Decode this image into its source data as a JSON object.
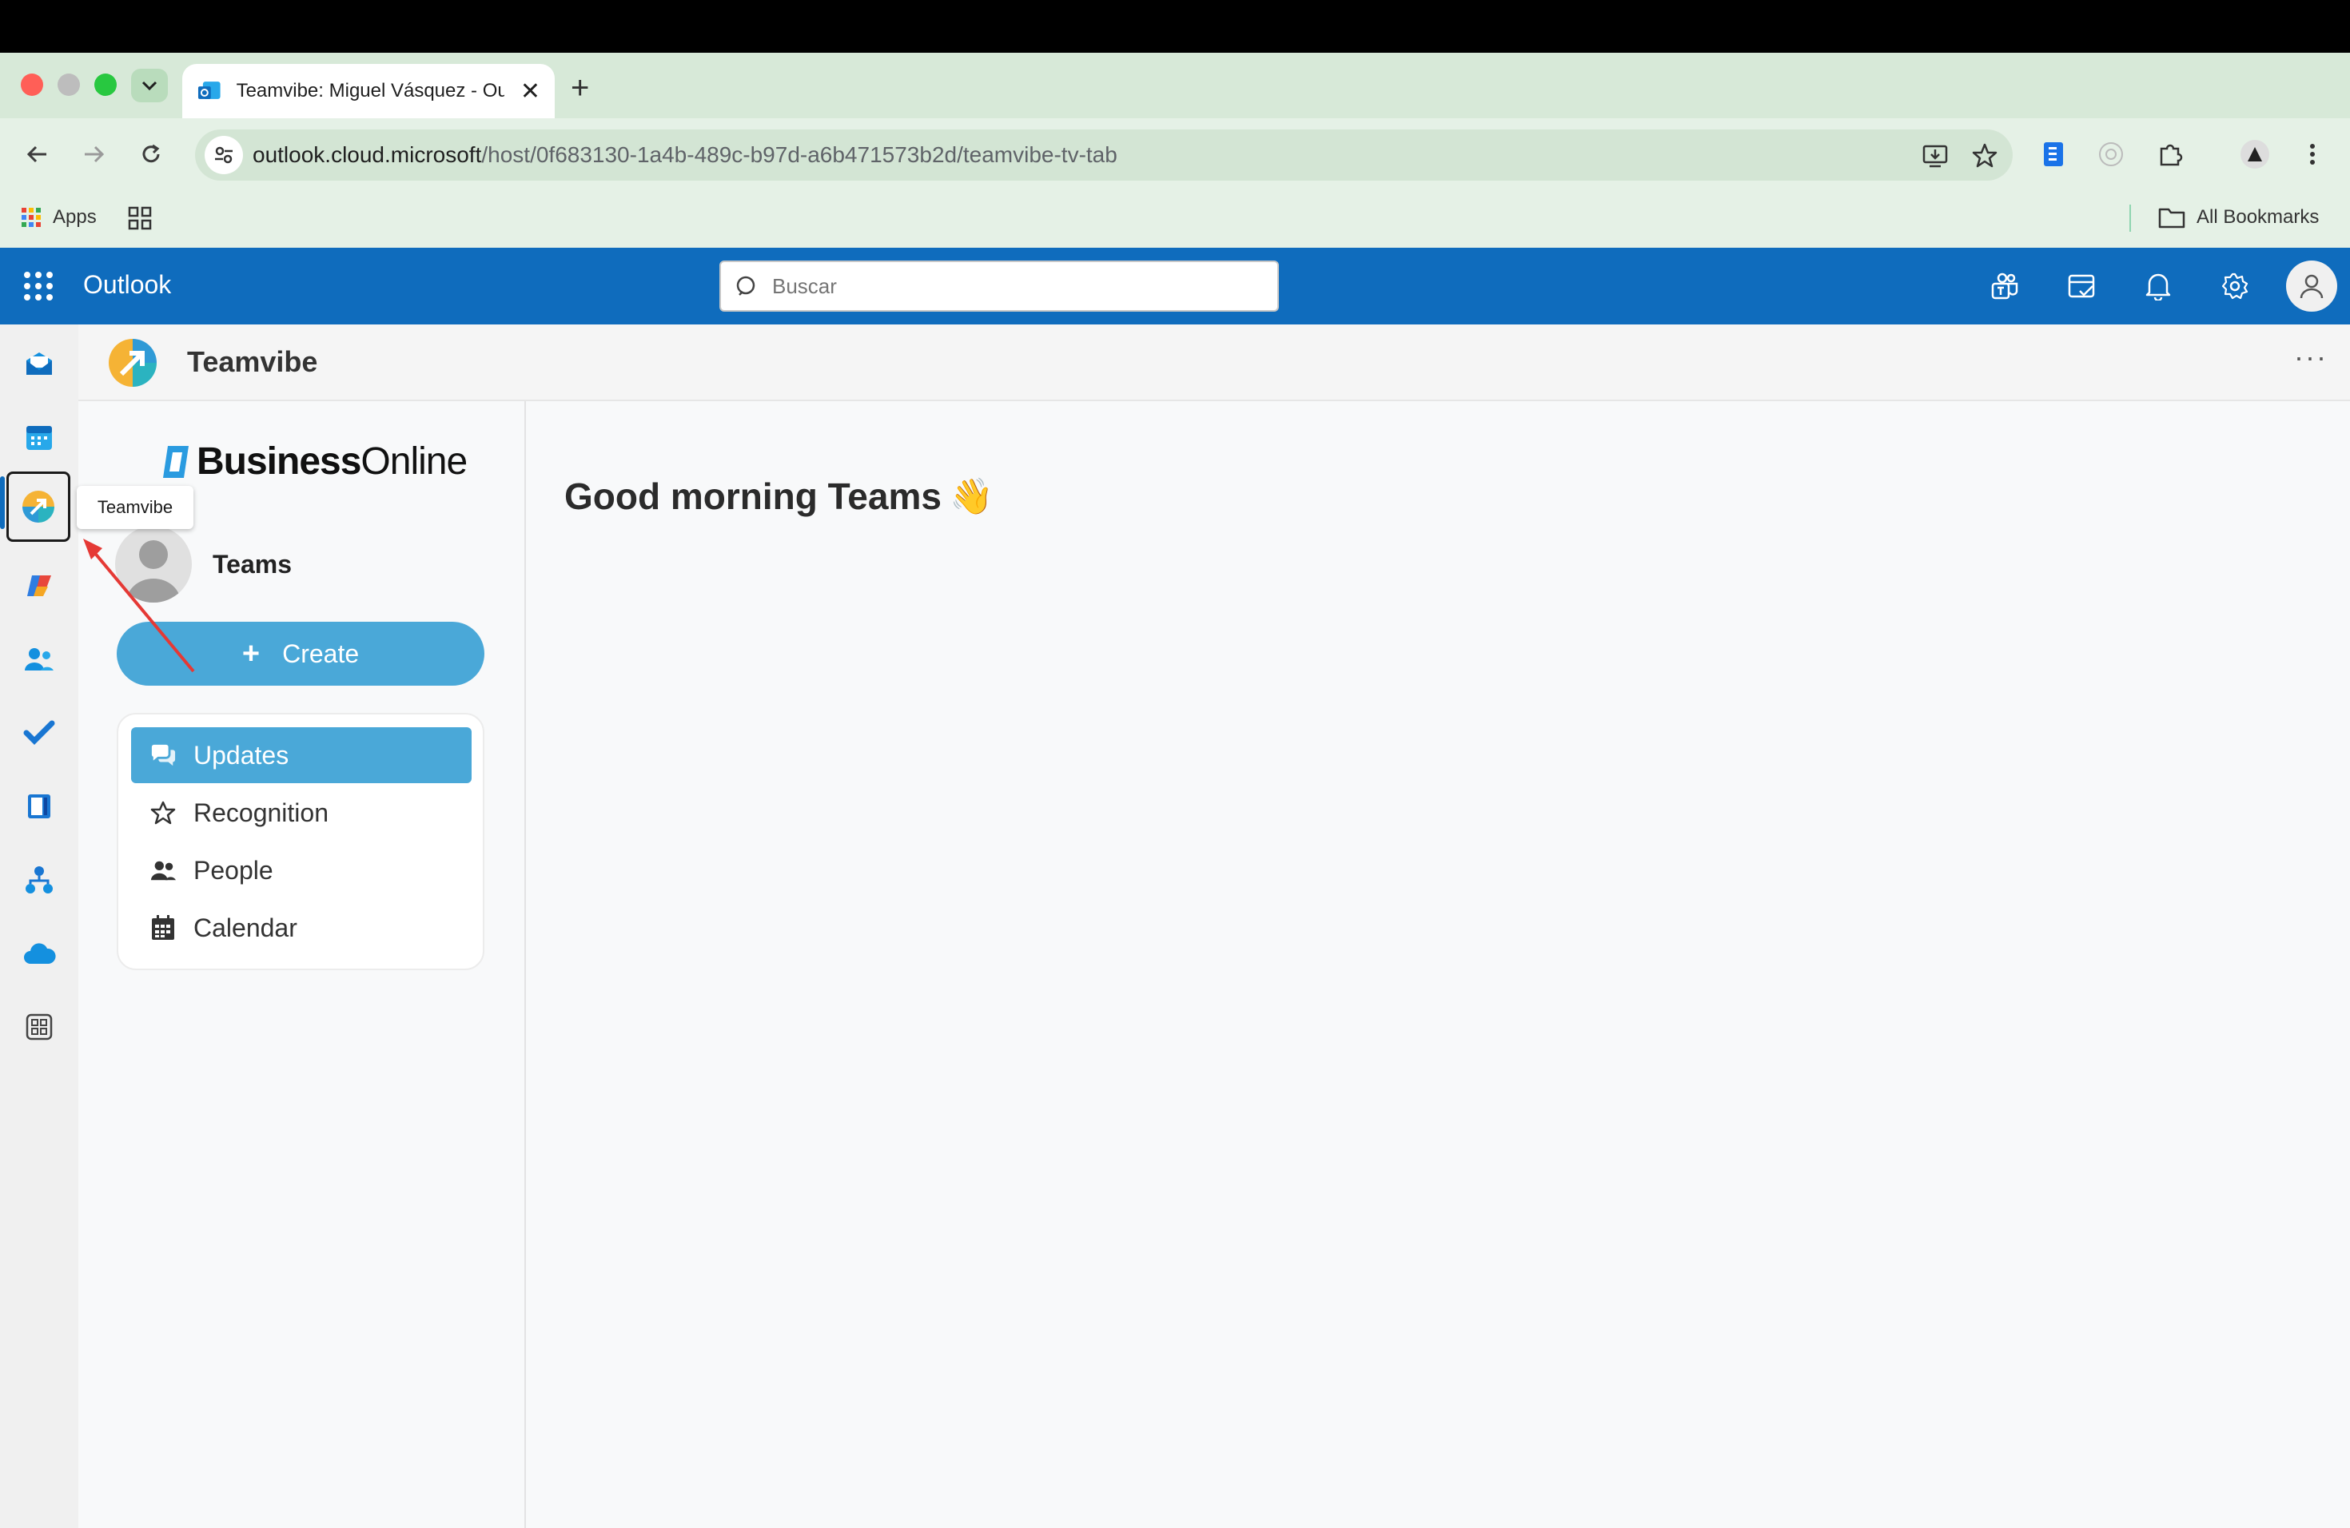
{
  "browser": {
    "tab_title": "Teamvibe: Miguel Vásquez - Outlook",
    "url_host": "outlook.cloud.microsoft",
    "url_path": "/host/0f683130-1a4b-489c-b97d-a6b471573b2d/teamvibe-tv-tab",
    "bookmarks": {
      "apps_label": "Apps",
      "all_bookmarks_label": "All Bookmarks"
    }
  },
  "outlook": {
    "app_title": "Outlook",
    "search_placeholder": "Buscar",
    "accent_color": "#0f6cbd"
  },
  "rail": {
    "items": [
      {
        "name": "mail-icon"
      },
      {
        "name": "calendar-icon"
      },
      {
        "name": "teamvibe-icon",
        "active": true
      },
      {
        "name": "copilot-icon"
      },
      {
        "name": "people-icon"
      },
      {
        "name": "todo-icon"
      },
      {
        "name": "notes-icon"
      },
      {
        "name": "org-icon"
      },
      {
        "name": "onedrive-icon"
      },
      {
        "name": "more-apps-icon"
      }
    ],
    "tooltip": "Teamvibe"
  },
  "app": {
    "name": "Teamvibe",
    "more_label": "···"
  },
  "sidebar": {
    "brand_bold": "Business",
    "brand_light": "Online",
    "profile_name": "Teams",
    "create_label": "Create",
    "menu": [
      {
        "label": "Updates",
        "icon": "chat-bubbles-icon",
        "active": true
      },
      {
        "label": "Recognition",
        "icon": "star-icon",
        "active": false
      },
      {
        "label": "People",
        "icon": "people-icon",
        "active": false
      },
      {
        "label": "Calendar",
        "icon": "calendar-icon",
        "active": false
      }
    ],
    "accent_color": "#4aa8d8"
  },
  "main": {
    "greeting": "Good morning Teams",
    "greeting_emoji": "👋"
  }
}
